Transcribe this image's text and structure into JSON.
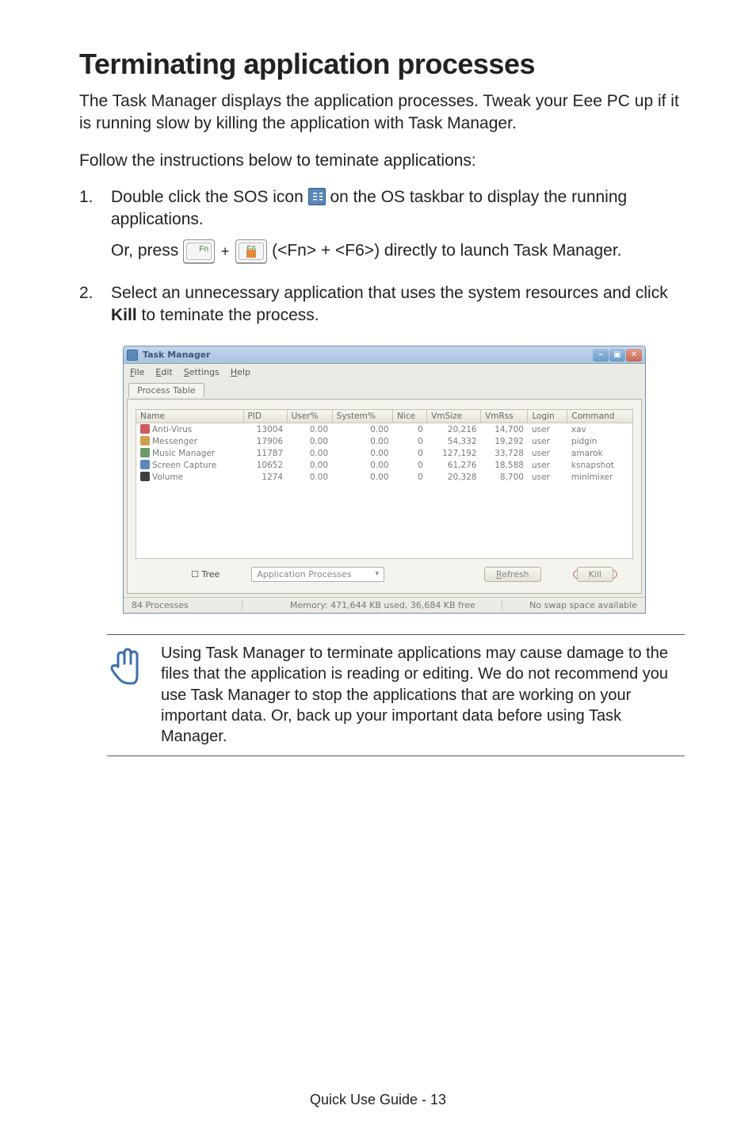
{
  "heading": "Terminating application processes",
  "intro": "The Task Manager displays the application processes. Tweak your Eee PC up if it is running slow by killing the application with Task Manager.",
  "follow": "Follow the instructions below to teminate applications:",
  "step1": {
    "num": "1.",
    "line1a": "Double click the SOS icon ",
    "line1b": " on the OS taskbar to display the running applications.",
    "line2a": "Or, press ",
    "keyFn": "Fn",
    "keyF6": "F6",
    "line2b": " (<Fn> + <F6>) directly to launch Task Manager."
  },
  "step2": {
    "num": "2.",
    "text_a": "Select an unnecessary application that uses the system resources and click ",
    "bold": "Kill",
    "text_b": " to teminate the process."
  },
  "tm": {
    "title": "Task Manager",
    "menu": {
      "file": "File",
      "edit": "Edit",
      "settings": "Settings",
      "help": "Help"
    },
    "tab": "Process Table",
    "cols": [
      "Name",
      "PID",
      "User%",
      "System%",
      "Nice",
      "VmSize",
      "VmRss",
      "Login",
      "Command"
    ],
    "rows": [
      {
        "icon": "#d05a5a",
        "name": "Anti-Virus",
        "pid": "13004",
        "user": "0.00",
        "sys": "0.00",
        "nice": "0",
        "vmsize": "20,216",
        "vmrss": "14,700",
        "login": "user",
        "cmd": "xav"
      },
      {
        "icon": "#d0a050",
        "name": "Messenger",
        "pid": "17906",
        "user": "0.00",
        "sys": "0.00",
        "nice": "0",
        "vmsize": "54,332",
        "vmrss": "19,292",
        "login": "user",
        "cmd": "pidgin"
      },
      {
        "icon": "#6a9a6a",
        "name": "Music Manager",
        "pid": "11787",
        "user": "0.00",
        "sys": "0.00",
        "nice": "0",
        "vmsize": "127,192",
        "vmrss": "33,728",
        "login": "user",
        "cmd": "amarok"
      },
      {
        "icon": "#5a88b9",
        "name": "Screen Capture",
        "pid": "10652",
        "user": "0.00",
        "sys": "0.00",
        "nice": "0",
        "vmsize": "61,276",
        "vmrss": "18,588",
        "login": "user",
        "cmd": "ksnapshot"
      },
      {
        "icon": "#404040",
        "name": "Volume",
        "pid": "1274",
        "user": "0.00",
        "sys": "0.00",
        "nice": "0",
        "vmsize": "20,328",
        "vmrss": "8,700",
        "login": "user",
        "cmd": "minimixer"
      }
    ],
    "tree": "Tree",
    "appproc": "Application Processes",
    "refresh": "Refresh",
    "kill": "Kill",
    "status": {
      "left": "84 Processes",
      "mid": "Memory: 471,644 KB used, 36,684 KB free",
      "right": "No swap space available"
    }
  },
  "note": "Using Task Manager to terminate applications may cause damage to the files that the application is reading or editing. We do not recommend you use Task Manager to stop the applications that are working on your important data. Or, back up your important data before using Task Manager.",
  "footer": "Quick Use Guide - 13"
}
